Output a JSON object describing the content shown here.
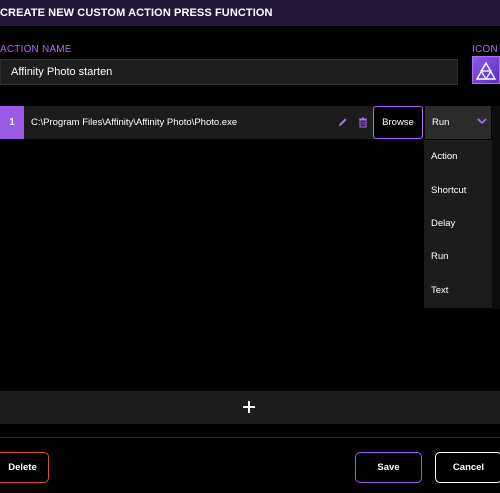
{
  "dialog": {
    "title": "CREATE NEW CUSTOM ACTION PRESS FUNCTION"
  },
  "form": {
    "action_name_label": "ACTION NAME",
    "action_name_value": "Affinity Photo starten",
    "icon_label": "ICON",
    "icon": "affinity-photo-icon"
  },
  "steps": [
    {
      "number": "1",
      "path": "C:\\Program Files\\Affinity\\Affinity Photo\\Photo.exe",
      "type": "Run"
    }
  ],
  "row_controls": {
    "browse_label": "Browse",
    "edit_icon": "pencil-icon",
    "delete_icon": "trash-icon"
  },
  "type_dropdown": {
    "selected": "Run",
    "options": [
      "Action",
      "Shortcut",
      "Delay",
      "Run",
      "Text"
    ]
  },
  "add_button": {
    "label": "+"
  },
  "footer": {
    "delete_label": "Delete",
    "save_label": "Save",
    "cancel_label": "Cancel"
  },
  "colors": {
    "accent": "#b06cf5",
    "step_badge": "#9a5be6",
    "danger": "#e04a4a",
    "title_bar": "#241838"
  }
}
